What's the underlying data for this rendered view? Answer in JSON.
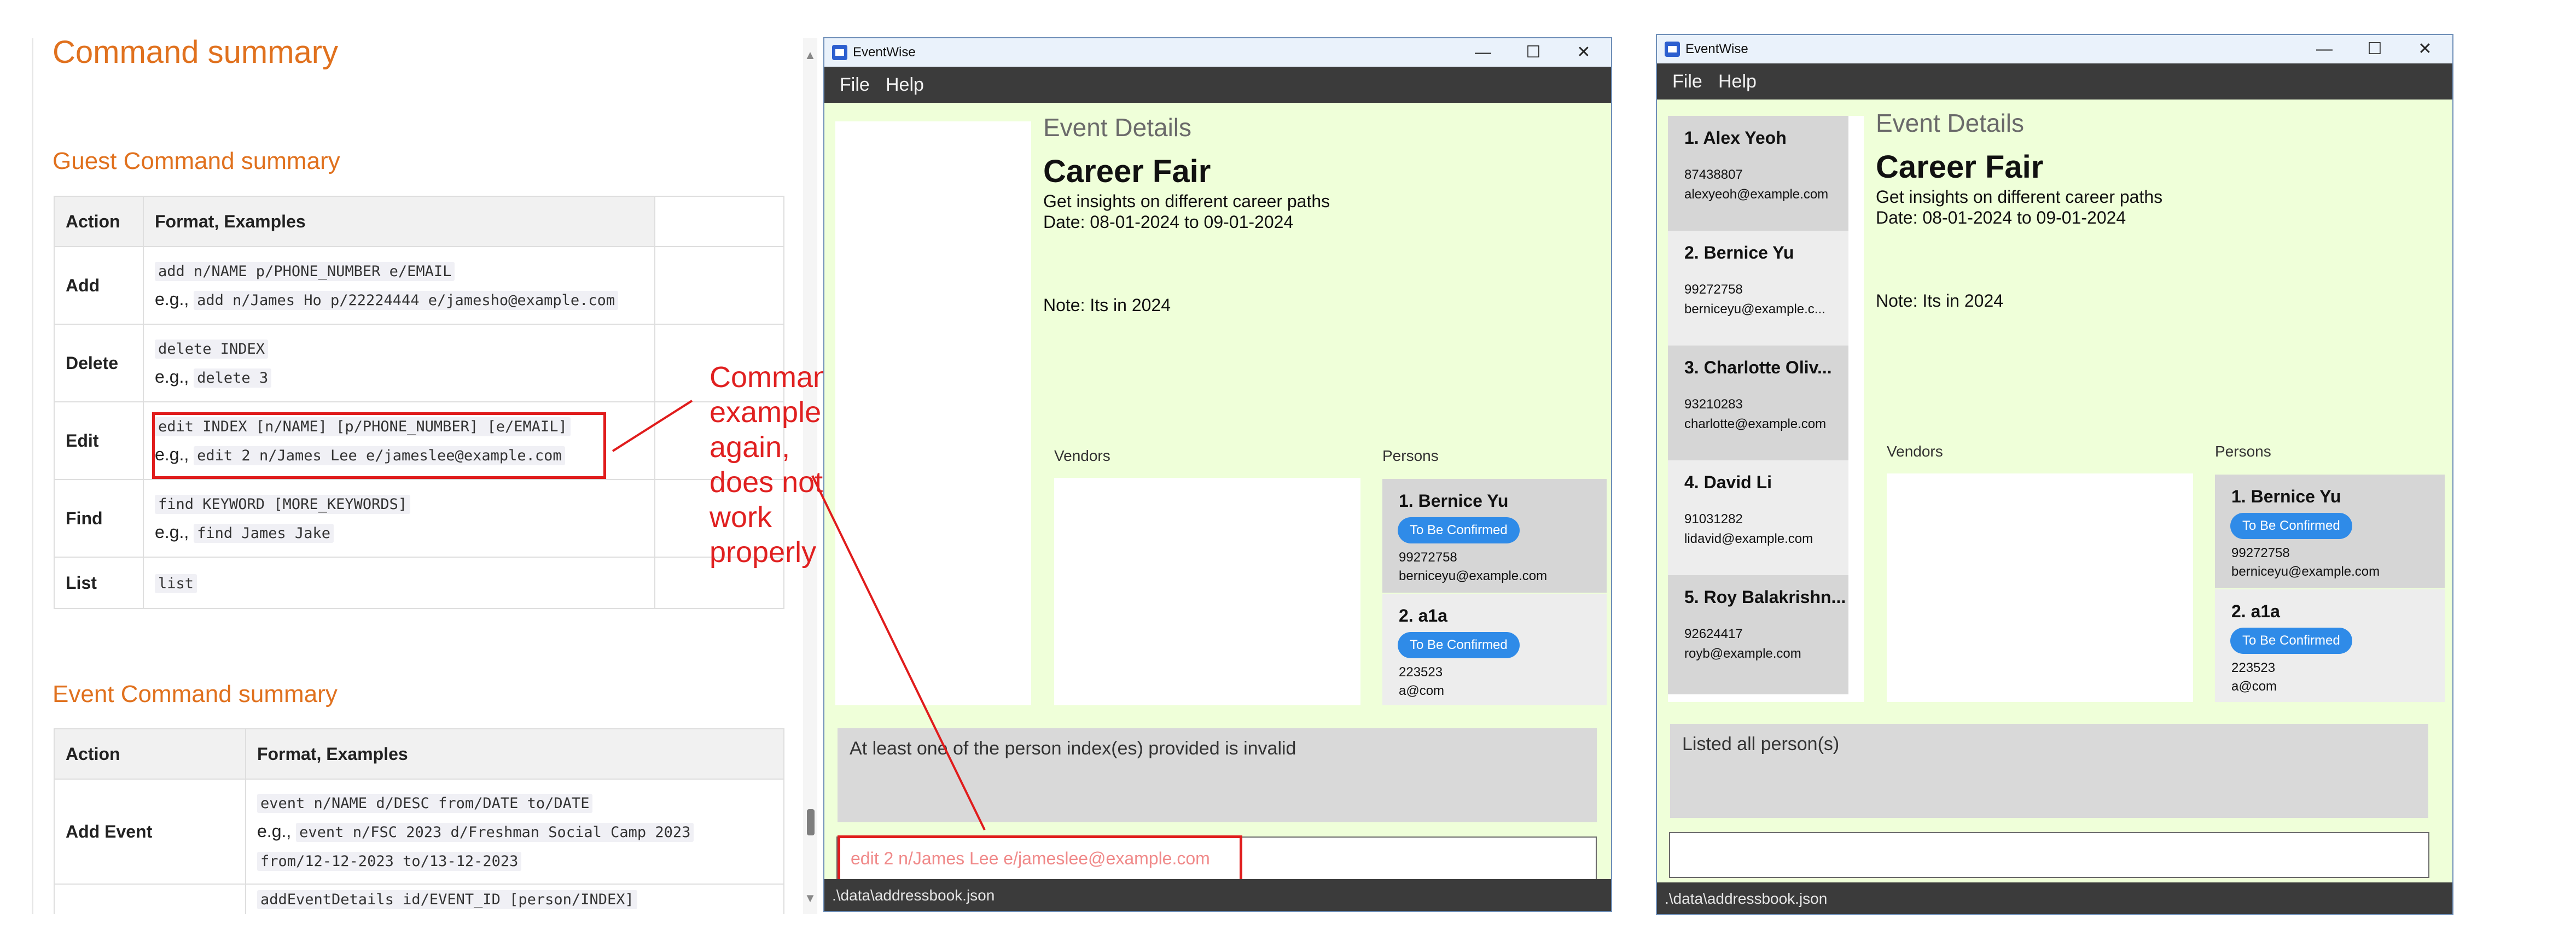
{
  "doc": {
    "heading": "Command summary",
    "guest_heading": "Guest Command summary",
    "event_heading": "Event Command summary",
    "guest_table": {
      "headers": [
        "Action",
        "Format, Examples"
      ],
      "rows": [
        {
          "action": "Add",
          "format": "add n/NAME p/PHONE_NUMBER e/EMAIL",
          "eg": "add n/James Ho p/22224444 e/jamesho@example.com"
        },
        {
          "action": "Delete",
          "format": "delete INDEX",
          "eg": "delete 3"
        },
        {
          "action": "Edit",
          "format": "edit INDEX [n/NAME] [p/PHONE_NUMBER] [e/EMAIL]",
          "eg": "edit 2 n/James Lee e/jameslee@example.com"
        },
        {
          "action": "Find",
          "format": "find KEYWORD [MORE_KEYWORDS]",
          "eg": "find James Jake"
        },
        {
          "action": "List",
          "format": "list",
          "eg": ""
        }
      ],
      "eg_prefix": "e.g.,"
    },
    "event_table": {
      "headers": [
        "Action",
        "Format, Examples"
      ],
      "rows": [
        {
          "action": "Add Event",
          "format": "event n/NAME d/DESC from/DATE to/DATE",
          "eg": "event n/FSC 2023 d/Freshman Social Camp 2023",
          "eg2": "from/12-12-2023 to/13-12-2023"
        },
        {
          "action": "",
          "format": "addEventDetails id/EVENT_ID [person/INDEX]",
          "eg": ""
        }
      ]
    },
    "annotation": [
      "Command example,",
      "again, does not work",
      "properly"
    ]
  },
  "win1": {
    "title": "EventWise",
    "menu": [
      "File",
      "Help"
    ],
    "event_details_label": "Event Details",
    "event_name": "Career Fair",
    "description": "Get insights on different career paths",
    "date": "Date: 08-01-2024 to 09-01-2024",
    "note": "Note: Its in 2024",
    "vendors_label": "Vendors",
    "persons_label": "Persons",
    "persons": [
      {
        "name": "1.  Bernice Yu",
        "badge": "To Be Confirmed",
        "phone": "99272758",
        "email": "berniceyu@example.com"
      },
      {
        "name": "2.  a1a",
        "badge": "To Be Confirmed",
        "phone": "223523",
        "email": "a@com"
      }
    ],
    "result": "At least one of the person index(es) provided is invalid",
    "command": "edit 2 n/James Lee e/jameslee@example.com",
    "status": ".\\data\\addressbook.json"
  },
  "win2": {
    "title": "EventWise",
    "menu": [
      "File",
      "Help"
    ],
    "contacts": [
      {
        "name": "1.  Alex Yeoh",
        "phone": "87438807",
        "email": "alexyeoh@example.com"
      },
      {
        "name": "2.  Bernice Yu",
        "phone": "99272758",
        "email": "berniceyu@example.c..."
      },
      {
        "name": "3.  Charlotte Oliv...",
        "phone": "93210283",
        "email": "charlotte@example.com"
      },
      {
        "name": "4.  David Li",
        "phone": "91031282",
        "email": "lidavid@example.com"
      },
      {
        "name": "5.  Roy Balakrishn...",
        "phone": "92624417",
        "email": "royb@example.com"
      }
    ],
    "event_details_label": "Event Details",
    "event_name": "Career Fair",
    "description": "Get insights on different career paths",
    "date": "Date: 08-01-2024 to 09-01-2024",
    "note": "Note: Its in 2024",
    "vendors_label": "Vendors",
    "persons_label": "Persons",
    "persons": [
      {
        "name": "1.  Bernice Yu",
        "badge": "To Be Confirmed",
        "phone": "99272758",
        "email": "berniceyu@example.com"
      },
      {
        "name": "2.  a1a",
        "badge": "To Be Confirmed",
        "phone": "223523",
        "email": "a@com"
      }
    ],
    "result": "Listed all person(s)",
    "status": ".\\data\\addressbook.json"
  },
  "colors": {
    "accent_orange": "#e0711e",
    "annotation_red": "#e02020",
    "badge_blue": "#2f8be8",
    "window_bg": "#efffd9"
  }
}
